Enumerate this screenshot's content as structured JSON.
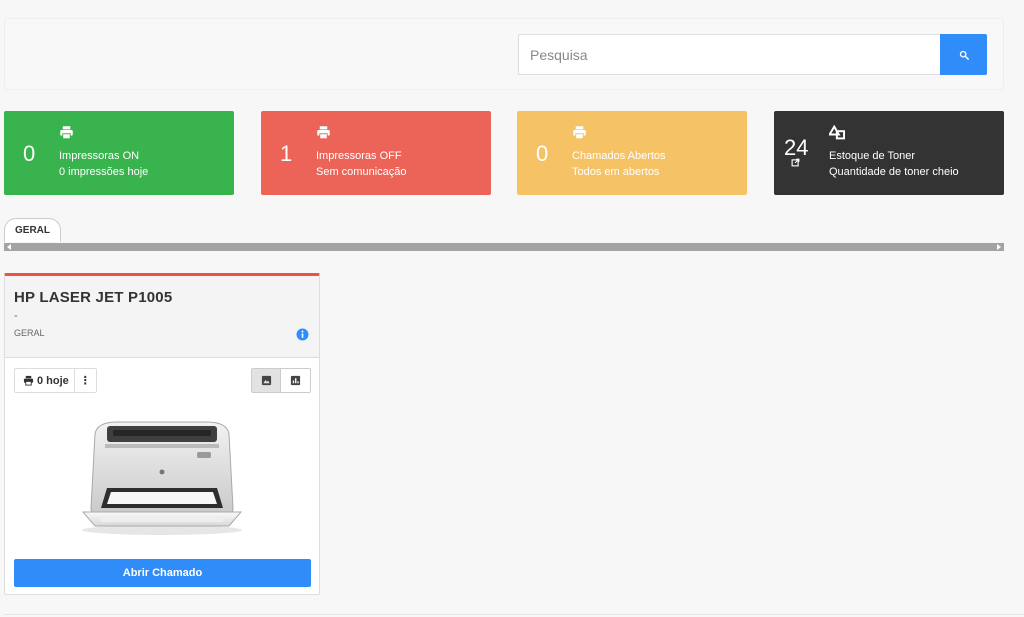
{
  "search": {
    "placeholder": "Pesquisa"
  },
  "cards": {
    "on": {
      "value": "0",
      "line1": "Impressoras ON",
      "line2": "0 impressões hoje",
      "color": "#38b34d"
    },
    "off": {
      "value": "1",
      "line1": "Impressoras OFF",
      "line2": "Sem comunicação",
      "color": "#ec6457"
    },
    "chamados": {
      "value": "0",
      "line1": "Chamados Abertos",
      "line2": "Todos em abertos",
      "color": "#f6c266"
    },
    "toner": {
      "value": "24",
      "line1": "Estoque de Toner",
      "line2": "Quantidade de toner cheio",
      "color": "#333333"
    }
  },
  "tabs": [
    {
      "label": "GERAL"
    }
  ],
  "printer": {
    "name": "HP LASER JET P1005",
    "subtitle": "-",
    "group": "GERAL",
    "count_label": "0 hoje",
    "more_label": "⋮",
    "action_label": "Abrir Chamado",
    "accent": "#e85545"
  },
  "icons": {
    "search": "search-icon",
    "printer": "printer-icon",
    "toner": "toner-shapes-icon",
    "external": "external-link-icon",
    "info": "info-icon",
    "image_view": "image-icon",
    "chart_view": "bar-chart-icon"
  }
}
